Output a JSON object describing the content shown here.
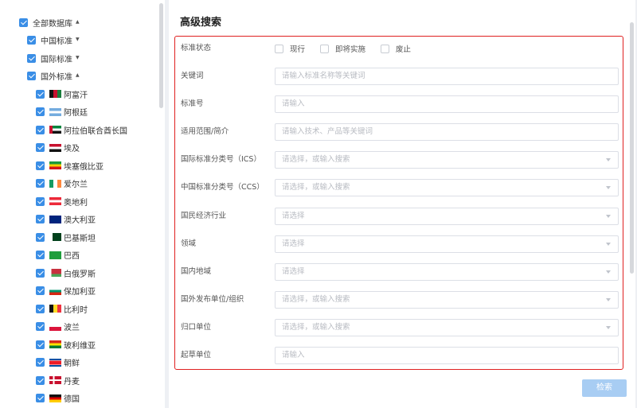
{
  "tree": {
    "root": {
      "label": "全部数据库"
    },
    "groups": [
      {
        "label": "中国标准"
      },
      {
        "label": "国际标准"
      },
      {
        "label": "国外标准"
      }
    ],
    "countries": [
      {
        "label": "阿富汗",
        "flag": "afghanistan-flag"
      },
      {
        "label": "阿根廷",
        "flag": "argentina-flag"
      },
      {
        "label": "阿拉伯联合酋长国",
        "flag": "uae-flag"
      },
      {
        "label": "埃及",
        "flag": "egypt-flag"
      },
      {
        "label": "埃塞俄比亚",
        "flag": "ethiopia-flag"
      },
      {
        "label": "爱尔兰",
        "flag": "ireland-flag"
      },
      {
        "label": "奥地利",
        "flag": "austria-flag"
      },
      {
        "label": "澳大利亚",
        "flag": "australia-flag"
      },
      {
        "label": "巴基斯坦",
        "flag": "pakistan-flag"
      },
      {
        "label": "巴西",
        "flag": "brazil-flag"
      },
      {
        "label": "白俄罗斯",
        "flag": "belarus-flag"
      },
      {
        "label": "保加利亚",
        "flag": "bulgaria-flag"
      },
      {
        "label": "比利时",
        "flag": "belgium-flag"
      },
      {
        "label": "波兰",
        "flag": "poland-flag"
      },
      {
        "label": "玻利维亚",
        "flag": "bolivia-flag"
      },
      {
        "label": "朝鲜",
        "flag": "north-korea-flag"
      },
      {
        "label": "丹麦",
        "flag": "denmark-flag"
      },
      {
        "label": "德国",
        "flag": "germany-flag"
      }
    ]
  },
  "search": {
    "title": "高级搜索",
    "status": {
      "label": "标准状态",
      "options": [
        "现行",
        "即将实施",
        "废止"
      ]
    },
    "fields": [
      {
        "label": "关键词",
        "placeholder": "请输入标准名称等关键词",
        "dropdown": false
      },
      {
        "label": "标准号",
        "placeholder": "请输入",
        "dropdown": false
      },
      {
        "label": "适用范围/简介",
        "placeholder": "请输入技术、产品等关键词",
        "dropdown": false
      },
      {
        "label": "国际标准分类号（ICS）",
        "placeholder": "请选择，或输入搜索",
        "dropdown": true
      },
      {
        "label": "中国标准分类号（CCS）",
        "placeholder": "请选择，或输入搜索",
        "dropdown": true
      },
      {
        "label": "国民经济行业",
        "placeholder": "请选择",
        "dropdown": true
      },
      {
        "label": "领域",
        "placeholder": "请选择",
        "dropdown": true
      },
      {
        "label": "国内地域",
        "placeholder": "请选择",
        "dropdown": true
      },
      {
        "label": "国外发布单位/组织",
        "placeholder": "请选择，或输入搜索",
        "dropdown": true
      },
      {
        "label": "归口单位",
        "placeholder": "请选择，或输入搜索",
        "dropdown": true
      },
      {
        "label": "起草单位",
        "placeholder": "请输入",
        "dropdown": false
      }
    ],
    "submit_label": "检索"
  },
  "colors": {
    "accent": "#3a8ee6",
    "highlight_border": "#e02020",
    "button_disabled": "#a8cdf3"
  }
}
